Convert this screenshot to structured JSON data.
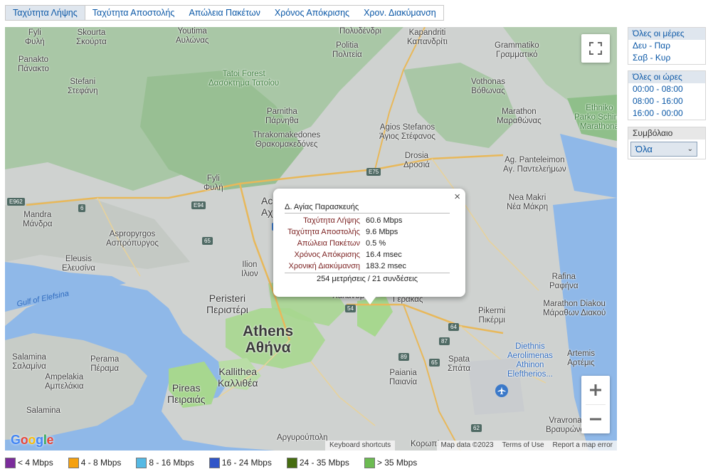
{
  "tabs": [
    {
      "label": "Ταχύτητα Λήψης",
      "active": true
    },
    {
      "label": "Ταχύτητα Αποστολής"
    },
    {
      "label": "Απώλεια Πακέτων"
    },
    {
      "label": "Χρόνος Απόκρισης"
    },
    {
      "label": "Χρον. Διακύμανση"
    }
  ],
  "map": {
    "labels": {
      "fyli_latin": "Fyli",
      "fyli_greek": "Φυλή",
      "skourta_latin": "Skourta",
      "skourta_greek": "Σκούρτα",
      "youtima": "Youtima",
      "avlonas": "Αυλώνας",
      "kapandriti_latin": "Kapandriti",
      "kapandriti_greek": "Καπανδρίτι",
      "polydendri": "Πολυδένδρι",
      "politia_latin": "Politia",
      "politia_greek": "Πολιτεία",
      "grammatiko_latin": "Grammatiko",
      "grammatiko_greek": "Γραμματικό",
      "panakto_latin": "Panakto",
      "panakto_greek": "Πάνακτο",
      "tatoi_latin": "Tatoi Forest",
      "tatoi_greek": "Δασόκτημα Τατοΐου",
      "stefani_latin": "Stefani",
      "stefani_greek": "Στεφάνη",
      "vothonas_latin": "Vothonas",
      "vothonas_greek": "Βόθωνας",
      "parnitha_latin": "Parnitha",
      "parnitha_greek": "Πάρνηθα",
      "thrako_latin": "Thrakomakedones",
      "thrako_greek": "Θρακομακεδόνες",
      "stefanos_latin": "Agios Stefanos",
      "stefanos_greek": "Άγιος Στέφανος",
      "marathon_latin": "Marathon",
      "marathon_greek": "Μαραθώνας",
      "ethniko": "Ethniko",
      "schinia": "Parko Schinia",
      "marathona": "Marathona",
      "drosia_latin": "Drosia",
      "drosia_greek": "Δροσιά",
      "panteleimon_latin": "Ag. Panteleimon",
      "panteleimon_greek": "Αγ. Παντελεήμων",
      "fyli2_latin": "Fyli",
      "fyli2_greek": "Φυλή",
      "acharnes_latin": "Ac",
      "acharnes_greek": "Αχ",
      "neamakri_latin": "Nea Makri",
      "neamakri_greek": "Νέα Μάκρη",
      "mandra_latin": "Mandra",
      "mandra_greek": "Μάνδρα",
      "aspropyrgos_latin": "Aspropyrgos",
      "aspropyrgos_greek": "Ασπρόπυργος",
      "elefsina_latin": "Eleusis",
      "elefsina_greek": "Ελευσίνα",
      "ilion_latin": "Ilion",
      "ilion_greek": "Ιλιον",
      "gulf": "Gulf of Elefsina",
      "rafina_latin": "Rafina",
      "rafina_greek": "Ραφήνα",
      "peristeri_latin": "Peristeri",
      "peristeri_greek": "Περιστέρι",
      "chalandri_greek": "Χαλάνδρι",
      "gerakas_greek": "Γέρακας",
      "pikermi_latin": "Pikermi",
      "pikermi_greek": "Πικέρμι",
      "marathon_diak_latin": "Marathon Diakou",
      "marathon_diak_greek": "Μάραθων Διακού",
      "athens_latin": "Athens",
      "athens_greek": "Αθήνα",
      "diethnis": "Diethnis",
      "aerolimenas": "Aerolimenas",
      "athinon": "Athinon",
      "eleftherios": "Eleftherios...",
      "artemis_latin": "Artemis",
      "artemis_greek": "Αρτέμις",
      "salamina_latin": "Salamina",
      "salamina_greek": "Σαλαμίνα",
      "perama_latin": "Perama",
      "perama_greek": "Πέραμα",
      "spata_latin": "Spata",
      "spata_greek": "Σπάτα",
      "kallithea_latin": "Kallithea",
      "kallithea_greek": "Καλλιθέα",
      "ampelakia_latin": "Ampelakia",
      "ampelakia_greek": "Αμπελάκια",
      "paiania_latin": "Paiania",
      "paiania_greek": "Παιανία",
      "pireas_latin": "Pireas",
      "pireas_greek": "Πειραιάς",
      "salamina2": "Salamina",
      "vravrona_latin": "Vravrona",
      "vravrona_greek": "Βραυρώνα",
      "argyroupoli": "Αργυρούπολη",
      "koropi": "Κορωπί"
    },
    "shields": [
      "E962",
      "6",
      "E94",
      "65",
      "E75",
      "1",
      "54",
      "64",
      "87",
      "89",
      "65",
      "62"
    ],
    "google": "Google",
    "keyboard": "Keyboard shortcuts",
    "attribution": [
      "Map data ©2023",
      "Terms of Use",
      "Report a map error"
    ],
    "icons": {
      "fullscreen": "fullscreen-icon",
      "zoom_in": "plus-icon",
      "zoom_out": "minus-icon",
      "airport": "airplane-icon"
    }
  },
  "popup": {
    "title": "Δ. Αγίας Παρασκευής",
    "rows": [
      {
        "label": "Ταχύτητα Λήψης",
        "value": "60.6 Mbps"
      },
      {
        "label": "Ταχύτητα Αποστολής",
        "value": "9.6 Mbps"
      },
      {
        "label": "Απώλεια Πακέτων",
        "value": "0.5 %"
      },
      {
        "label": "Χρόνος Απόκρισης",
        "value": "16.4 msec"
      },
      {
        "label": "Χρονική Διακύμανση",
        "value": "183.2 msec"
      }
    ],
    "footer": "254 μετρήσεις / 21 συνδέσεις",
    "close": "×"
  },
  "filters": {
    "days": {
      "title": "Όλες οι μέρες",
      "items": [
        "Δευ - Παρ",
        "Σαβ - Κυρ"
      ]
    },
    "hours": {
      "title": "Όλες οι ώρες",
      "items": [
        "00:00 - 08:00",
        "08:00 - 16:00",
        "16:00 - 00:00"
      ]
    },
    "contract": {
      "title": "Συμβόλαιο",
      "selected": "Όλα"
    }
  },
  "legend": [
    {
      "label": "< 4 Mbps",
      "color": "#7b2c9b"
    },
    {
      "label": "4 - 8 Mbps",
      "color": "#f5a10f"
    },
    {
      "label": "8 - 16 Mbps",
      "color": "#55b9e4"
    },
    {
      "label": "16 - 24 Mbps",
      "color": "#3055c8"
    },
    {
      "label": "24 - 35 Mbps",
      "color": "#466d10"
    },
    {
      "label": "> 35 Mbps",
      "color": "#6cbb52"
    }
  ]
}
